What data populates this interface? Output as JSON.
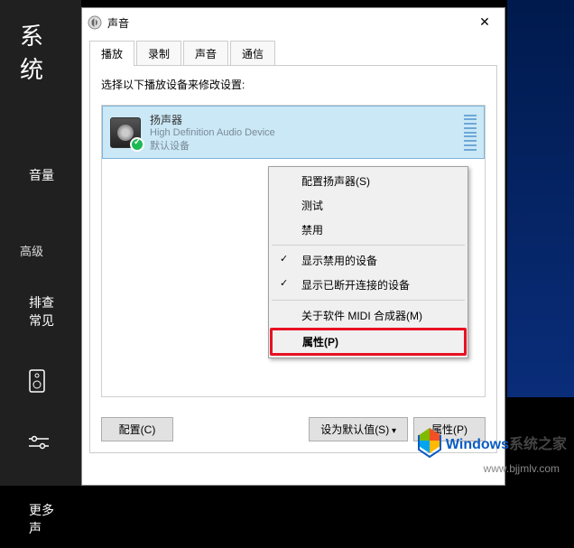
{
  "sidebar": {
    "title": "系统",
    "items": [
      {
        "label": "音量"
      },
      {
        "label": "高级",
        "section": true
      },
      {
        "label": "排查常见"
      },
      {
        "label": "更多声"
      }
    ]
  },
  "dialog": {
    "title": "声音",
    "tabs": [
      "播放",
      "录制",
      "声音",
      "通信"
    ],
    "instruction": "选择以下播放设备来修改设置:",
    "device": {
      "name": "扬声器",
      "desc": "High Definition Audio Device",
      "status": "默认设备"
    },
    "buttons": {
      "configure": "配置(C)",
      "setDefault": "设为默认值(S)",
      "properties": "属性(P)"
    }
  },
  "contextMenu": {
    "items": [
      {
        "label": "配置扬声器(S)"
      },
      {
        "label": "测试"
      },
      {
        "label": "禁用"
      },
      {
        "sep": true
      },
      {
        "label": "显示禁用的设备",
        "checked": true
      },
      {
        "label": "显示已断开连接的设备",
        "checked": true
      },
      {
        "sep": true
      },
      {
        "label": "关于软件 MIDI 合成器(M)"
      },
      {
        "label": "属性(P)",
        "highlight": true
      }
    ]
  },
  "watermark": {
    "text1": "Windows",
    "text2": "系统之家",
    "url": "www.bjjmlv.com"
  }
}
